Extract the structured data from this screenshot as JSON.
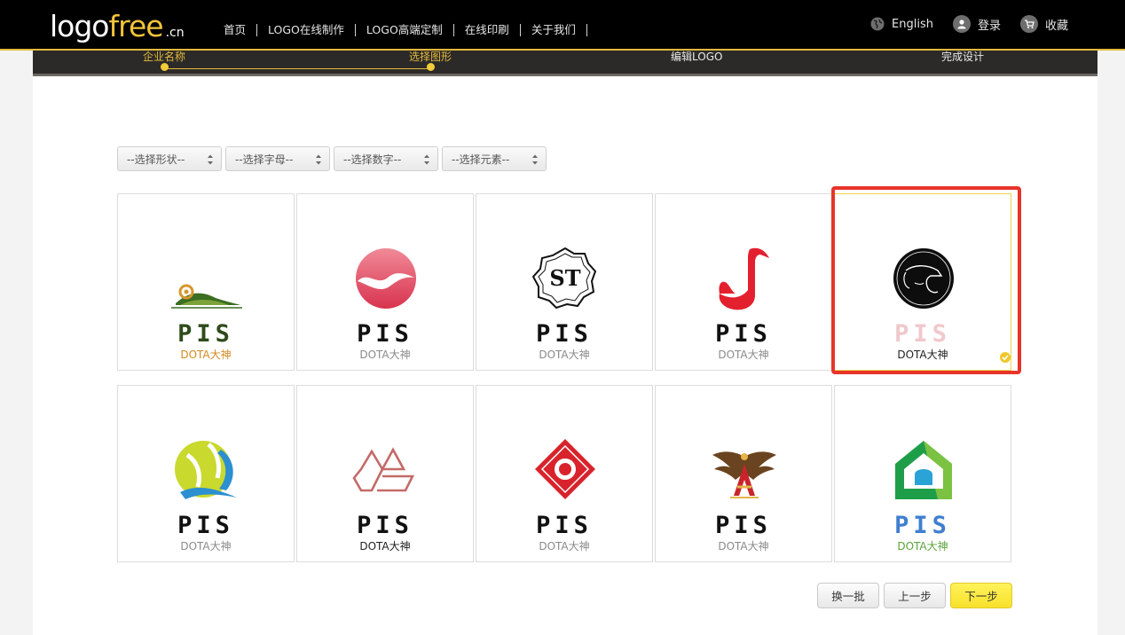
{
  "header": {
    "logo": {
      "main": "logo",
      "accent": "free",
      "suffix": ".cn"
    },
    "nav": [
      {
        "label": "首页"
      },
      {
        "label": "LOGO在线制作"
      },
      {
        "label": "LOGO高端定制"
      },
      {
        "label": "在线印刷"
      },
      {
        "label": "关于我们"
      }
    ],
    "language": "English",
    "login": "登录",
    "favorites": "收藏"
  },
  "steps": [
    {
      "label": "企业名称",
      "done": true
    },
    {
      "label": "选择图形",
      "done": true
    },
    {
      "label": "编辑LOGO",
      "done": false
    },
    {
      "label": "完成设计",
      "done": false
    }
  ],
  "filters": [
    {
      "selected": "--选择形状--"
    },
    {
      "selected": "--选择字母--"
    },
    {
      "selected": "--选择数字--"
    },
    {
      "selected": "--选择元素--"
    }
  ],
  "logos": [
    {
      "icon": "hills-swirl-icon",
      "brand": "PIS",
      "sub": "DOTA大神",
      "brand_color": "#2f4b1b",
      "sub_color": "#d28a20",
      "selected": false
    },
    {
      "icon": "pink-bird-circle-icon",
      "brand": "PIS",
      "sub": "DOTA大神",
      "brand_color": "#111111",
      "sub_color": "#8a8a8a",
      "selected": false
    },
    {
      "icon": "st-monogram-badge-icon",
      "brand": "PIS",
      "sub": "DOTA大神",
      "brand_color": "#111111",
      "sub_color": "#8a8a8a",
      "selected": false
    },
    {
      "icon": "swan-note-icon",
      "brand": "PIS",
      "sub": "DOTA大神",
      "brand_color": "#111111",
      "sub_color": "#8a8a8a",
      "selected": false
    },
    {
      "icon": "face-profile-circle-icon",
      "brand": "PIS",
      "sub": "DOTA大神",
      "brand_color": "#f0c8cc",
      "sub_color": "#222222",
      "selected": true
    },
    {
      "icon": "q-ball-icon",
      "brand": "PIS",
      "sub": "DOTA大神",
      "brand_color": "#111111",
      "sub_color": "#8a8a8a",
      "selected": false
    },
    {
      "icon": "outline-hexagon-g-icon",
      "brand": "PIS",
      "sub": "DOTA大神",
      "brand_color": "#111111",
      "sub_color": "#222222",
      "selected": false
    },
    {
      "icon": "red-diamond-target-icon",
      "brand": "PIS",
      "sub": "DOTA大神",
      "brand_color": "#111111",
      "sub_color": "#8a8a8a",
      "selected": false
    },
    {
      "icon": "eagle-a-crest-icon",
      "brand": "PIS",
      "sub": "DOTA大神",
      "brand_color": "#111111",
      "sub_color": "#8a8a8a",
      "selected": false
    },
    {
      "icon": "green-house-icon",
      "brand": "PIS",
      "sub": "DOTA大神",
      "brand_color": "#3f7fd0",
      "sub_color": "#5aa33a",
      "selected": false
    }
  ],
  "buttons": {
    "refresh": "换一批",
    "prev": "上一步",
    "next": "下一步"
  },
  "colors": {
    "accent": "#e4b93d",
    "selection_frame": "#e7342a",
    "next_button": "#f8e12c"
  }
}
